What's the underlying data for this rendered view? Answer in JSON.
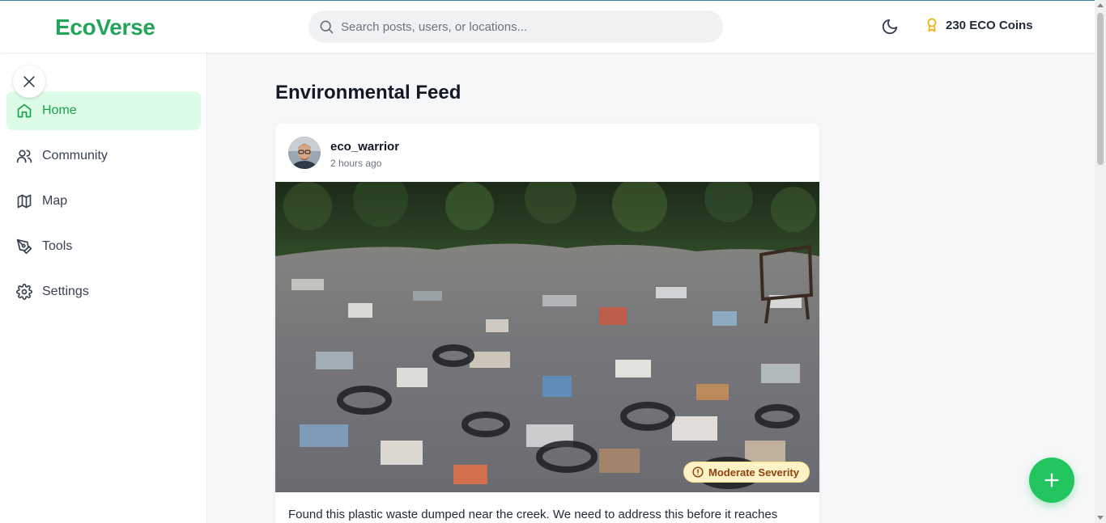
{
  "app": {
    "logo": "EcoVerse",
    "brand_color": "#22a55a"
  },
  "header": {
    "search_placeholder": "Search posts, users, or locations...",
    "coins_label": "230 ECO Coins",
    "theme_icon": "moon-icon",
    "coins_icon": "award-icon"
  },
  "sidebar": {
    "close_icon": "close-icon",
    "items": [
      {
        "label": "Home",
        "icon": "home-icon",
        "active": true
      },
      {
        "label": "Community",
        "icon": "users-icon",
        "active": false
      },
      {
        "label": "Map",
        "icon": "map-icon",
        "active": false
      },
      {
        "label": "Tools",
        "icon": "pen-tool-icon",
        "active": false
      },
      {
        "label": "Settings",
        "icon": "gear-icon",
        "active": false
      }
    ]
  },
  "main": {
    "title": "Environmental Feed",
    "posts": [
      {
        "username": "eco_warrior",
        "time": "2 hours ago",
        "severity": "Moderate Severity",
        "severity_color": "#92400e",
        "caption": "Found this plastic waste dumped near the creek. We need to address this before it reaches"
      }
    ]
  },
  "fab": {
    "icon": "plus-icon"
  }
}
